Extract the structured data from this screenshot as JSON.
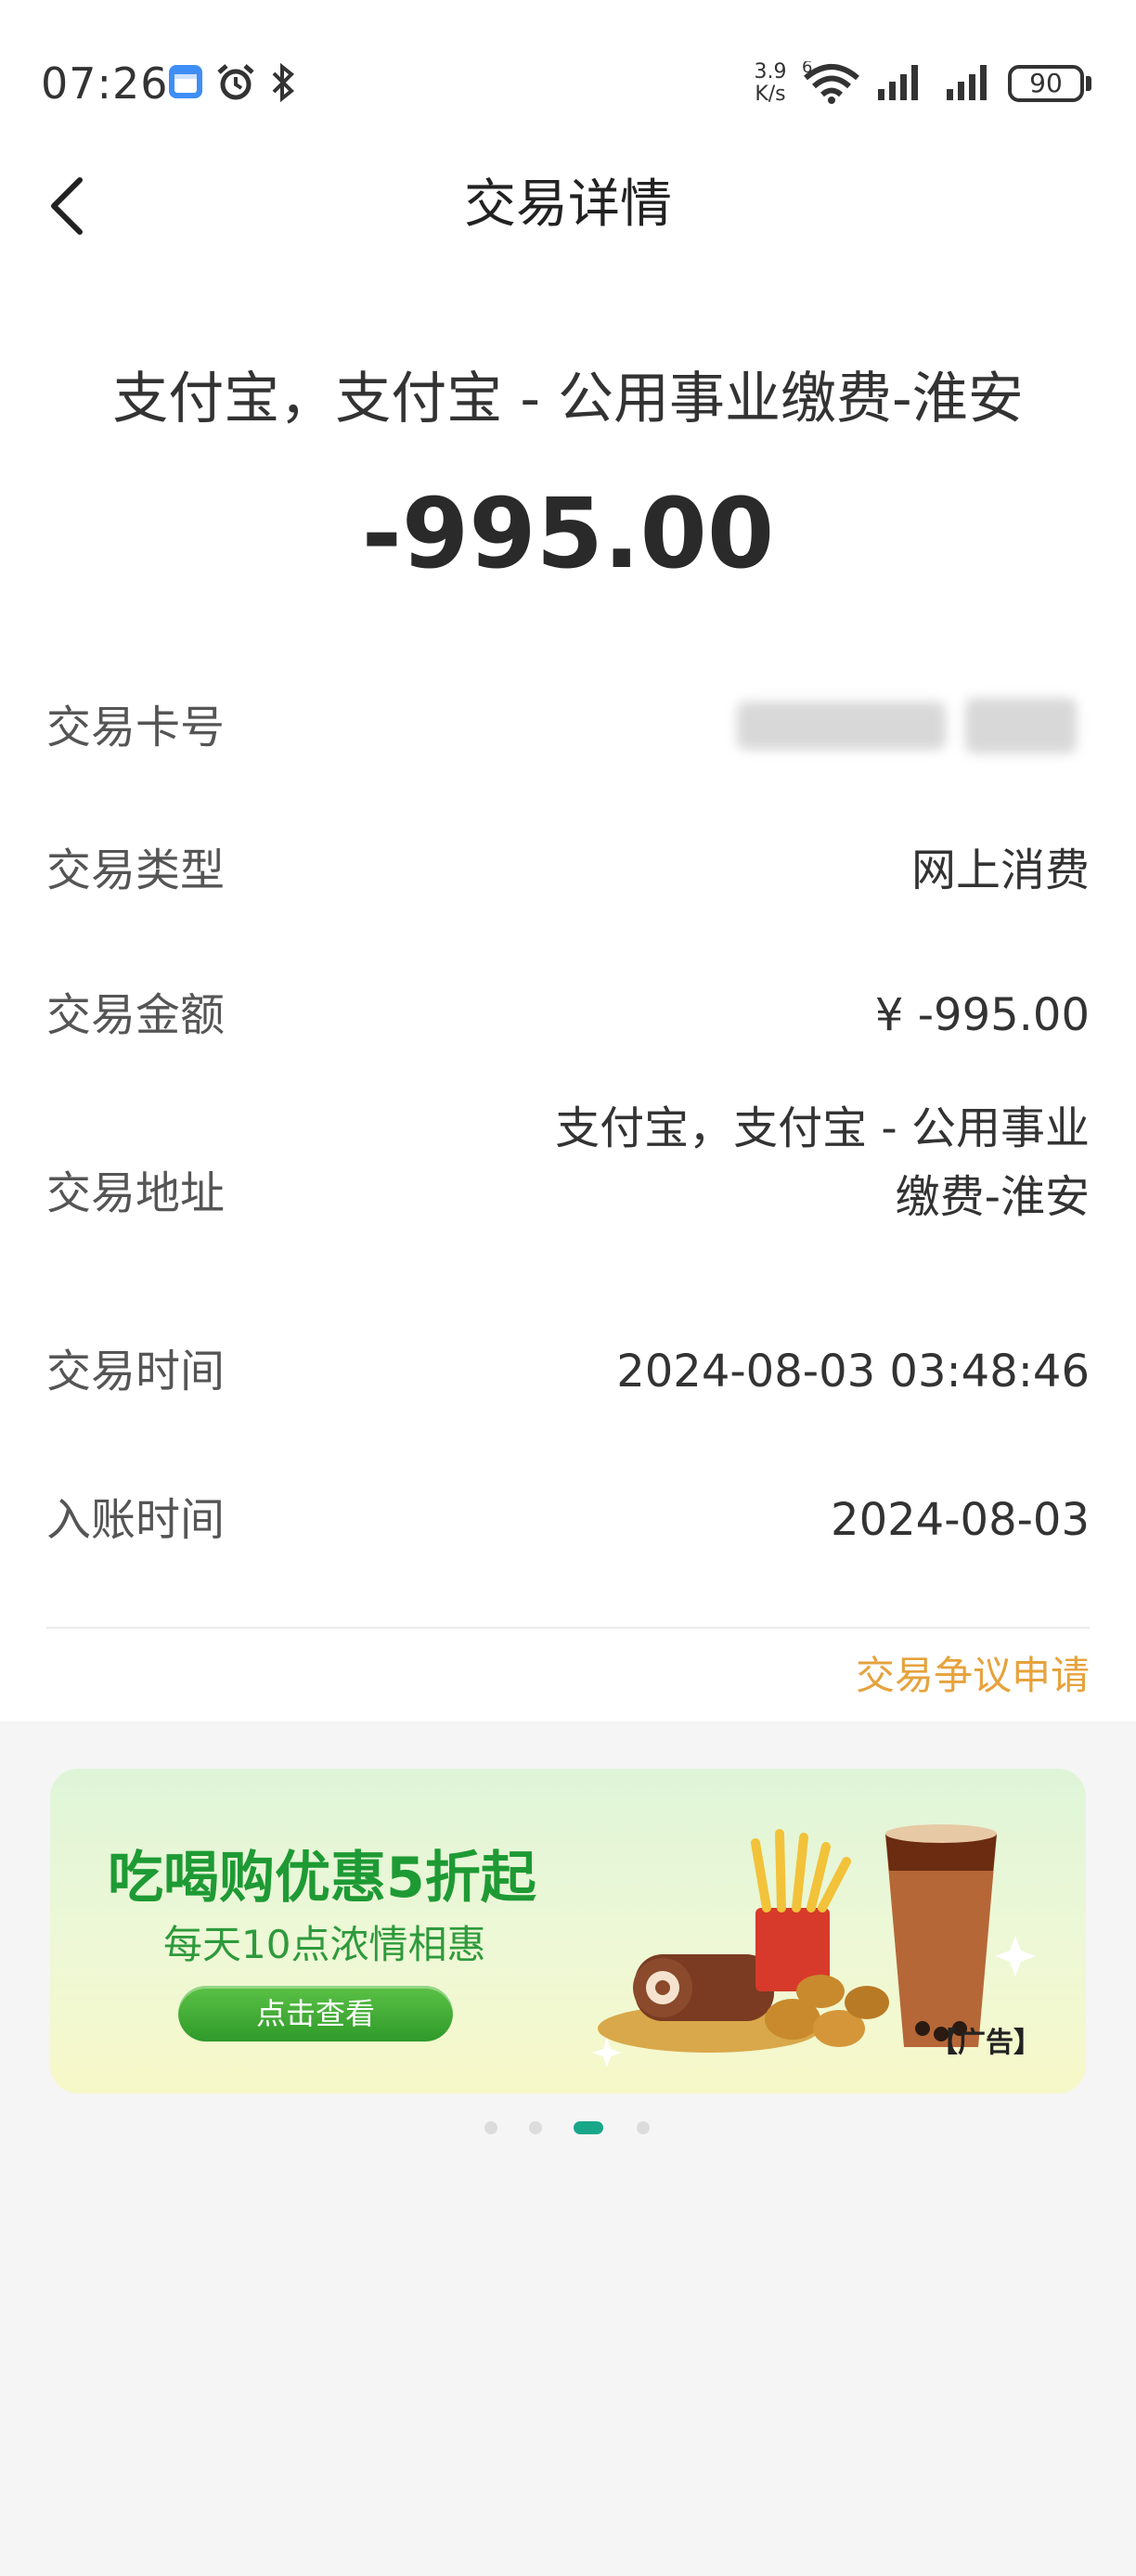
{
  "status_bar": {
    "time": "07:26",
    "net_speed_value": "3.9",
    "net_speed_unit": "K/s",
    "wifi_badge": "6",
    "battery": "90",
    "icons": [
      "calendar-icon",
      "alarm-icon",
      "bluetooth-icon",
      "wifi-icon",
      "signal-icon",
      "signal-icon",
      "battery-icon"
    ]
  },
  "header": {
    "title": "交易详情",
    "back_icon": "chevron-left-icon"
  },
  "summary": {
    "merchant": "支付宝，支付宝 - 公用事业缴费-淮安",
    "amount": "-995.00"
  },
  "details": [
    {
      "label": "交易卡号",
      "value": ""
    },
    {
      "label": "交易类型",
      "value": "网上消费"
    },
    {
      "label": "交易金额",
      "value": "¥ -995.00"
    },
    {
      "label": "交易地址",
      "value_line1": "支付宝，支付宝 - 公用事业",
      "value_line2": "缴费-淮安"
    },
    {
      "label": "交易时间",
      "value": "2024-08-03 03:48:46"
    },
    {
      "label": "入账时间",
      "value": "2024-08-03"
    }
  ],
  "dispute_link": "交易争议申请",
  "ad": {
    "headline": "吃喝购优惠5折起",
    "subline": "每天10点浓情相惠",
    "cta": "点击查看",
    "tag": "【广告】"
  },
  "carousel": {
    "count": 4,
    "active_index": 2
  },
  "colors": {
    "accent_orange": "#e6a23c",
    "ad_green": "#1e9a34",
    "dot_active": "#19a78a"
  }
}
